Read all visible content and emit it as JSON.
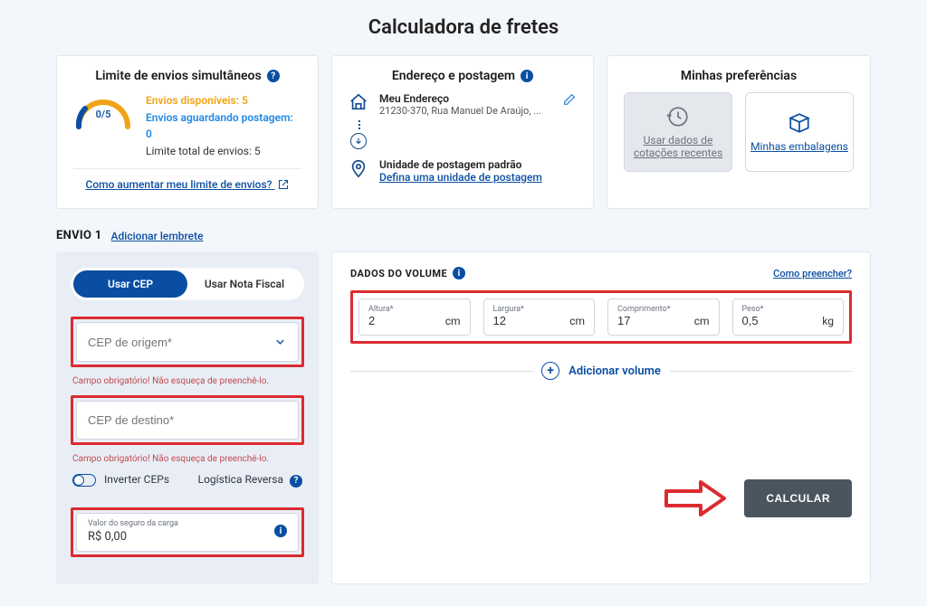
{
  "title": "Calculadora de fretes",
  "cards": {
    "limits": {
      "title": "Limite de envios simultâneos",
      "gauge": "0/5",
      "available_line": "Envios disponíveis: 5",
      "waiting_line": "Envios aguardando postagem: 0",
      "total_line": "Limite total de envios: 5",
      "increase_link": "Como aumentar meu limite de envios?"
    },
    "address": {
      "title": "Endereço e postagem",
      "my_address_label": "Meu Endereço",
      "my_address_value": "21230-370, Rua Manuel De Araújo, ...",
      "post_unit_label": "Unidade de postagem padrão",
      "post_unit_link": "Defina uma unidade de postagem"
    },
    "prefs": {
      "title": "Minhas preferências",
      "recent_btn": "Usar dados de cotações recentes",
      "packages_btn": "Minhas embalagens"
    }
  },
  "envio": {
    "label": "ENVIO 1",
    "add_reminder": "Adicionar lembrete",
    "tab_cep": "Usar CEP",
    "tab_nf": "Usar Nota Fiscal",
    "cep_origin_placeholder": "CEP de origem*",
    "cep_dest_placeholder": "CEP de destino*",
    "required_error": "Campo obrigatório! Não esqueça de preenchê-lo.",
    "invert_ceps": "Inverter CEPs",
    "reverse_logistics": "Logística Reversa",
    "insurance_label": "Valor do seguro da carga",
    "insurance_value": "R$ 0,00"
  },
  "volume": {
    "title": "DADOS DO VOLUME",
    "how_link": "Como preencher?",
    "fields": {
      "altura": {
        "label": "Altura*",
        "value": "2",
        "unit": "cm"
      },
      "largura": {
        "label": "Largura*",
        "value": "12",
        "unit": "cm"
      },
      "comprimento": {
        "label": "Comprimento*",
        "value": "17",
        "unit": "cm"
      },
      "peso": {
        "label": "Peso*",
        "value": "0,5",
        "unit": "kg"
      }
    },
    "add_volume": "Adicionar volume",
    "calc_button": "CALCULAR"
  }
}
